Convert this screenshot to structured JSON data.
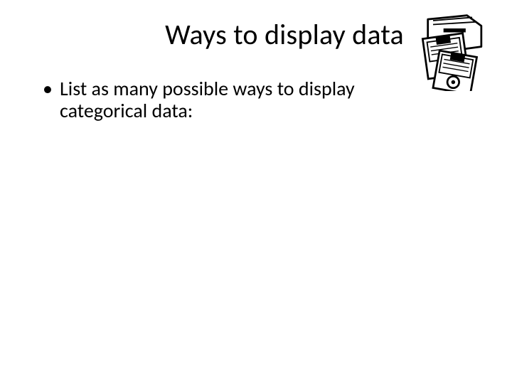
{
  "slide": {
    "title": "Ways to display data",
    "bullet1": "List as many possible ways to display categorical data:",
    "image_alt": "floppy-disks-clipart"
  }
}
